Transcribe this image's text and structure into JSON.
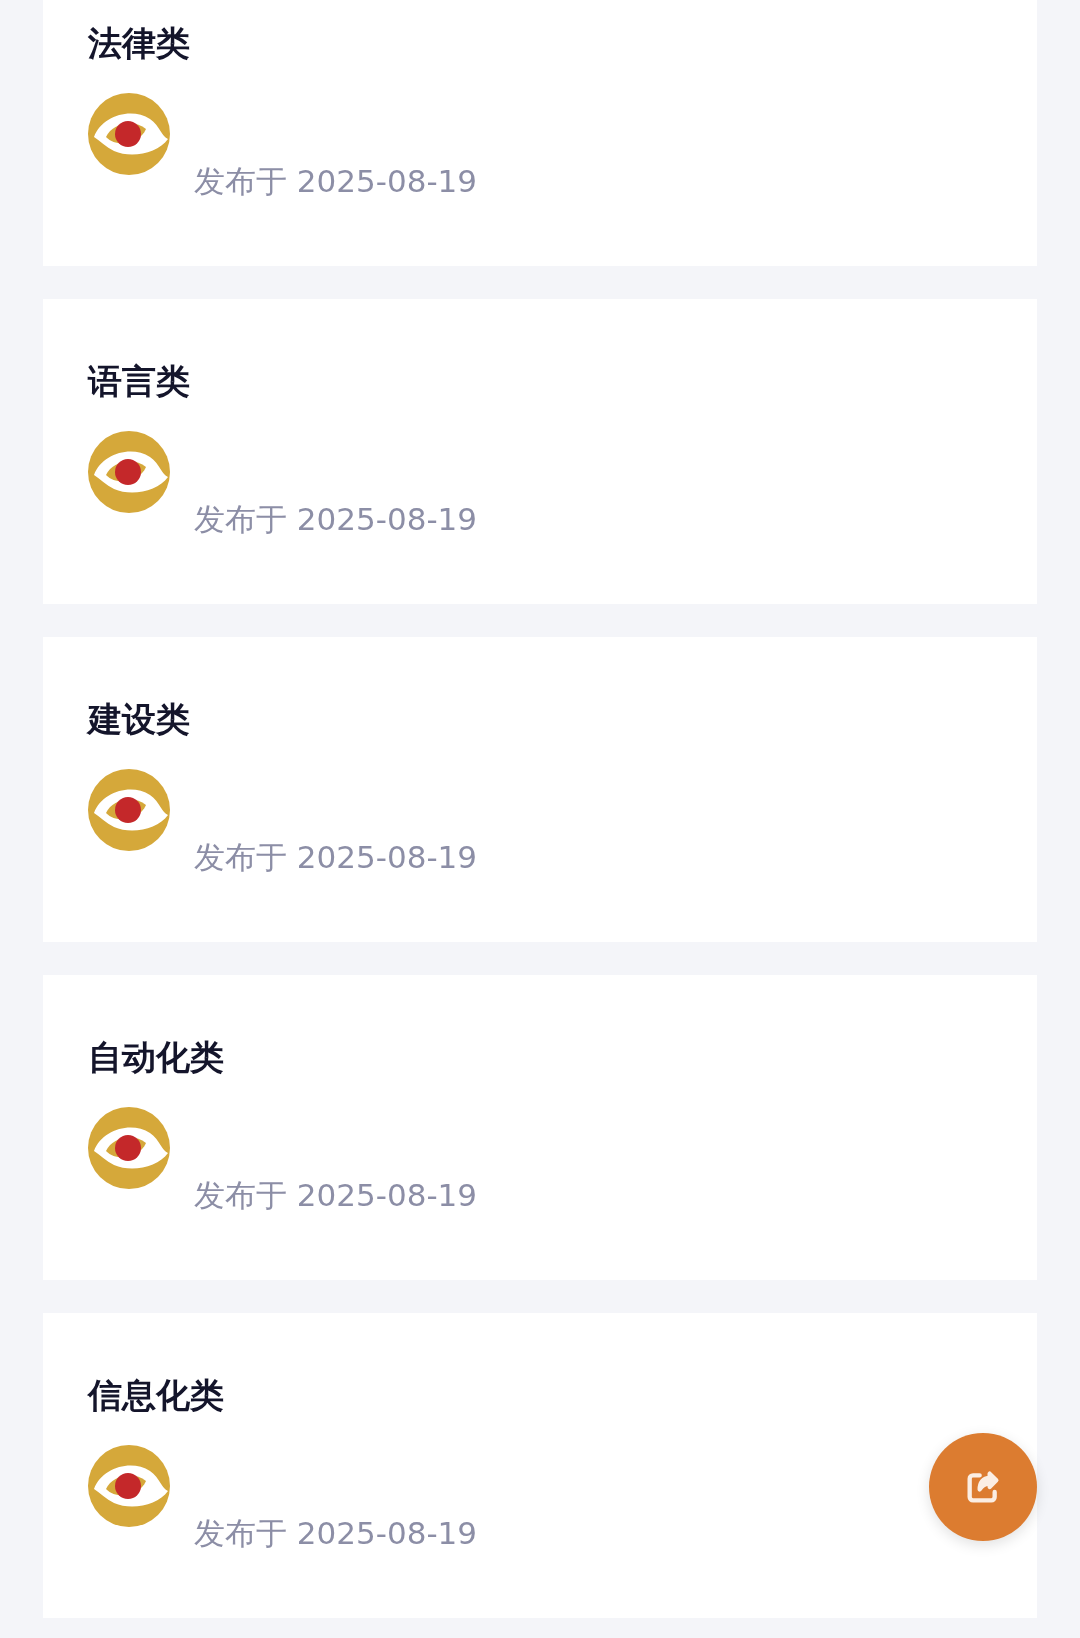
{
  "articles": [
    {
      "title": "法律类",
      "date": "发布于 2025-08-19"
    },
    {
      "title": "语言类",
      "date": "发布于 2025-08-19"
    },
    {
      "title": "建设类",
      "date": "发布于 2025-08-19"
    },
    {
      "title": "自动化类",
      "date": "发布于 2025-08-19"
    },
    {
      "title": "信息化类",
      "date": "发布于 2025-08-19"
    }
  ]
}
